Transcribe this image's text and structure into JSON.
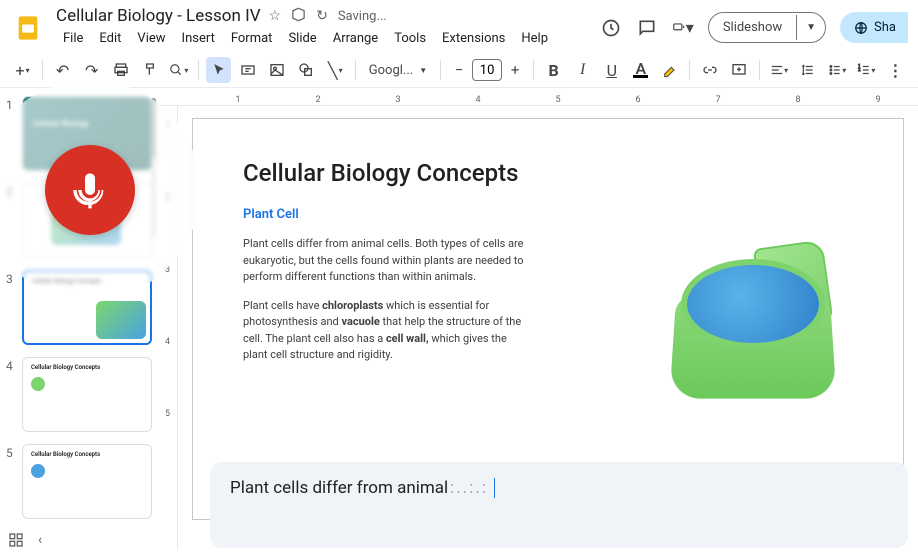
{
  "header": {
    "doc_title": "Cellular Biology - Lesson IV",
    "saving": "Saving...",
    "menu": [
      "File",
      "Edit",
      "View",
      "Insert",
      "Format",
      "Slide",
      "Arrange",
      "Tools",
      "Extensions",
      "Help"
    ],
    "slideshow": "Slideshow",
    "share": "Sha"
  },
  "toolbar": {
    "font_name": "Googl...",
    "font_size": "10"
  },
  "ruler_h": [
    "1",
    "2",
    "3",
    "4",
    "5",
    "6",
    "7",
    "8",
    "9"
  ],
  "ruler_v": [
    "1",
    "2",
    "3",
    "4",
    "5"
  ],
  "thumbnails": [
    {
      "num": "1",
      "title": "Cellular Biology"
    },
    {
      "num": "2",
      "title": ""
    },
    {
      "num": "3",
      "title": "Cellular Biology Concepts"
    },
    {
      "num": "4",
      "title": "Cellular Biology Concepts"
    },
    {
      "num": "5",
      "title": "Cellular Biology Concepts"
    }
  ],
  "slide": {
    "title": "Cellular Biology Concepts",
    "subtitle": "Plant Cell",
    "para1": "Plant cells differ from animal cells. Both types of cells are eukaryotic, but the cells found within plants are needed to perform different functions than within animals.",
    "para2a": "Plant cells have ",
    "para2b": "chloroplasts",
    "para2c": " which is essential for photosynthesis and ",
    "para2d": "vacuole",
    "para2e": " that help the structure of the cell. The plant cell also has a ",
    "para2f": "cell wall,",
    "para2g": " which gives the plant cell structure and rigidity."
  },
  "speaker_notes": {
    "text": "Plant cells differ from animal",
    "processing": ":..:.:"
  }
}
